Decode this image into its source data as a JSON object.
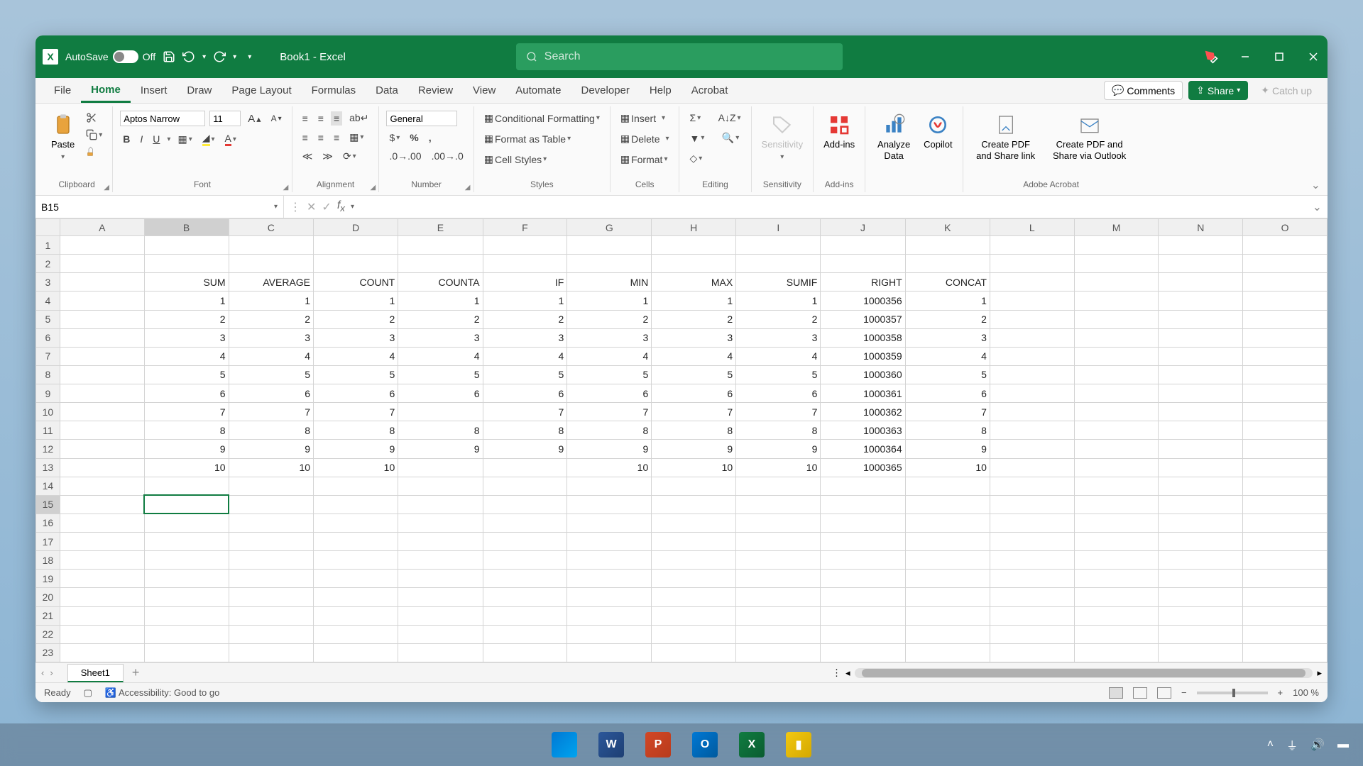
{
  "titlebar": {
    "autosave_label": "AutoSave",
    "autosave_state": "Off",
    "doc_title": "Book1  -  Excel",
    "search_placeholder": "Search"
  },
  "tabs": [
    "File",
    "Home",
    "Insert",
    "Draw",
    "Page Layout",
    "Formulas",
    "Data",
    "Review",
    "View",
    "Automate",
    "Developer",
    "Help",
    "Acrobat"
  ],
  "active_tab": "Home",
  "tabs_right": {
    "comments": "Comments",
    "share": "Share",
    "catchup": "Catch up"
  },
  "ribbon": {
    "clipboard": {
      "label": "Clipboard",
      "paste": "Paste"
    },
    "font": {
      "label": "Font",
      "font_name": "Aptos Narrow",
      "font_size": "11"
    },
    "alignment": {
      "label": "Alignment"
    },
    "number": {
      "label": "Number",
      "format": "General"
    },
    "styles": {
      "label": "Styles",
      "cond": "Conditional Formatting",
      "table": "Format as Table",
      "cell": "Cell Styles"
    },
    "cells": {
      "label": "Cells",
      "insert": "Insert",
      "delete": "Delete",
      "format": "Format"
    },
    "editing": {
      "label": "Editing"
    },
    "sensitivity": {
      "label": "Sensitivity",
      "btn": "Sensitivity"
    },
    "addins": {
      "label": "Add-ins",
      "btn": "Add-ins"
    },
    "analyze": "Analyze Data",
    "copilot": "Copilot",
    "adobe": {
      "label": "Adobe Acrobat",
      "share": "Create PDF and Share link",
      "outlook": "Create PDF and Share via Outlook"
    }
  },
  "name_box": "B15",
  "sheet": {
    "columns": [
      "A",
      "B",
      "C",
      "D",
      "E",
      "F",
      "G",
      "H",
      "I",
      "J",
      "K",
      "L",
      "M",
      "N",
      "O"
    ],
    "row_count": 23,
    "selected_cell": {
      "row": 15,
      "col": "B"
    },
    "headers_row": 3,
    "headers": {
      "B": "SUM",
      "C": "AVERAGE",
      "D": "COUNT",
      "E": "COUNTA",
      "F": "IF",
      "G": "MIN",
      "H": "MAX",
      "I": "SUMIF",
      "J": "RIGHT",
      "K": "CONCAT"
    },
    "data": {
      "4": {
        "B": "1",
        "C": "1",
        "D": "1",
        "E": "1",
        "F": "1",
        "G": "1",
        "H": "1",
        "I": "1",
        "J": "1000356",
        "K": "1"
      },
      "5": {
        "B": "2",
        "C": "2",
        "D": "2",
        "E": "2",
        "F": "2",
        "G": "2",
        "H": "2",
        "I": "2",
        "J": "1000357",
        "K": "2"
      },
      "6": {
        "B": "3",
        "C": "3",
        "D": "3",
        "E": "3",
        "F": "3",
        "G": "3",
        "H": "3",
        "I": "3",
        "J": "1000358",
        "K": "3"
      },
      "7": {
        "B": "4",
        "C": "4",
        "D": "4",
        "E": "4",
        "F": "4",
        "G": "4",
        "H": "4",
        "I": "4",
        "J": "1000359",
        "K": "4"
      },
      "8": {
        "B": "5",
        "C": "5",
        "D": "5",
        "E": "5",
        "F": "5",
        "G": "5",
        "H": "5",
        "I": "5",
        "J": "1000360",
        "K": "5"
      },
      "9": {
        "B": "6",
        "C": "6",
        "D": "6",
        "E": "6",
        "F": "6",
        "G": "6",
        "H": "6",
        "I": "6",
        "J": "1000361",
        "K": "6"
      },
      "10": {
        "B": "7",
        "C": "7",
        "D": "7",
        "E": "",
        "F": "7",
        "G": "7",
        "H": "7",
        "I": "7",
        "J": "1000362",
        "K": "7"
      },
      "11": {
        "B": "8",
        "C": "8",
        "D": "8",
        "E": "8",
        "F": "8",
        "G": "8",
        "H": "8",
        "I": "8",
        "J": "1000363",
        "K": "8"
      },
      "12": {
        "B": "9",
        "C": "9",
        "D": "9",
        "E": "9",
        "F": "9",
        "G": "9",
        "H": "9",
        "I": "9",
        "J": "1000364",
        "K": "9"
      },
      "13": {
        "B": "10",
        "C": "10",
        "D": "10",
        "E": "",
        "F": "",
        "G": "10",
        "H": "10",
        "I": "10",
        "J": "1000365",
        "K": "10"
      }
    }
  },
  "sheet_tabs": {
    "active": "Sheet1"
  },
  "status": {
    "ready": "Ready",
    "accessibility": "Accessibility: Good to go",
    "zoom": "100 %"
  }
}
